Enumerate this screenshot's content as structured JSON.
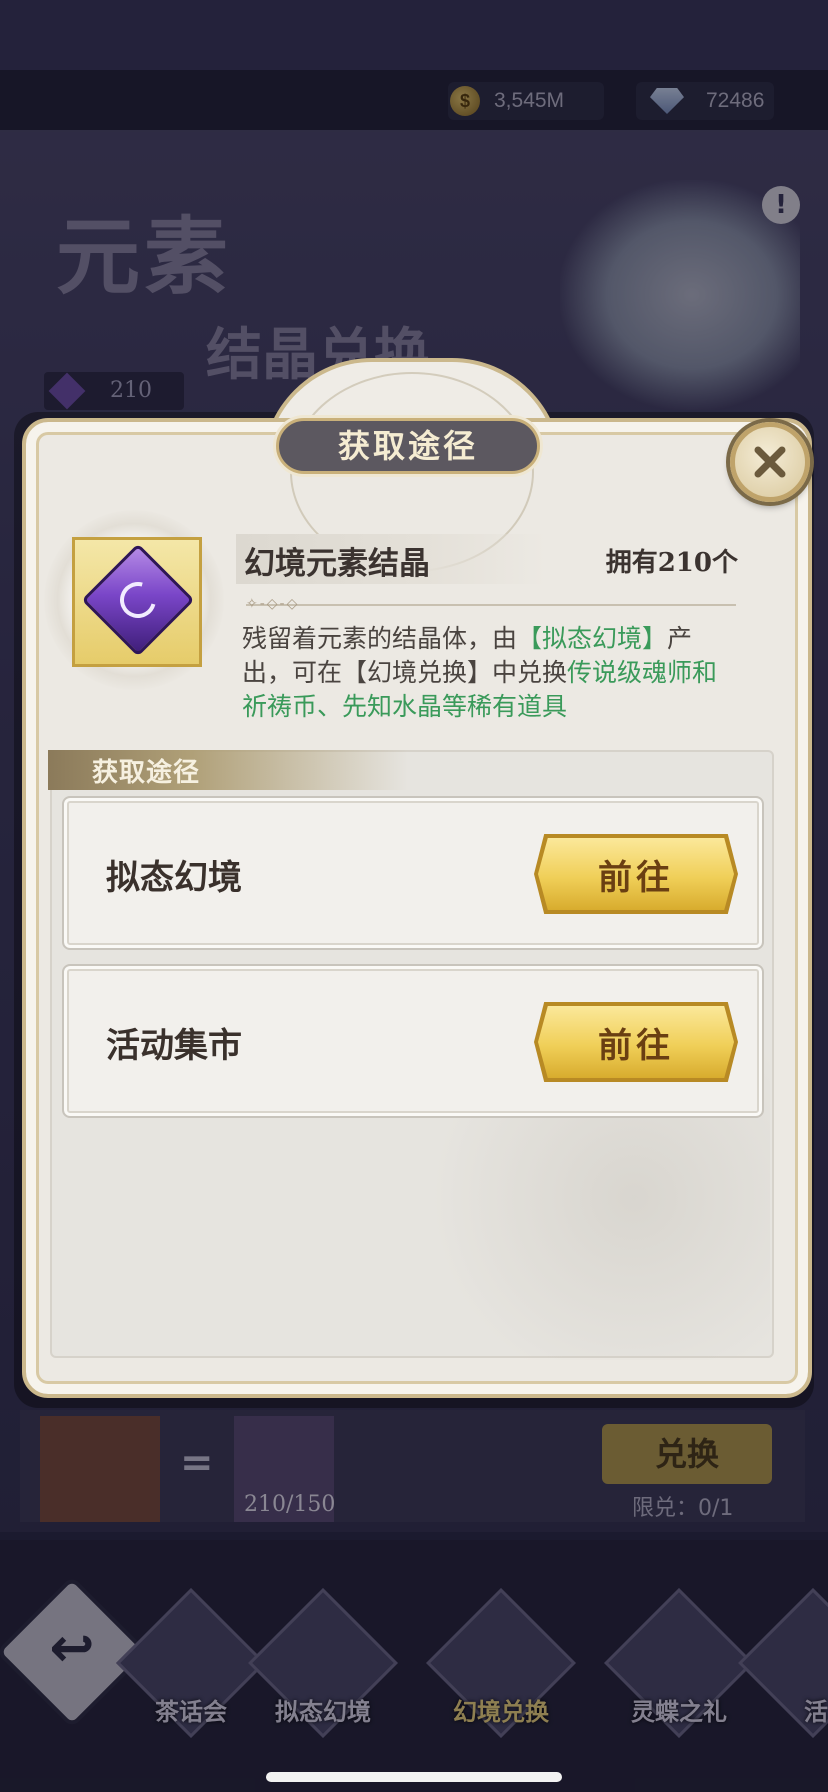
{
  "currency": {
    "gold": "3,545M",
    "gems": "72486"
  },
  "background": {
    "banner_line1": "元素",
    "banner_line2": "结晶兑换",
    "owned_count": "210",
    "exchange_button": "兑换",
    "exchange_limit": "限兑：0/1",
    "item_progress": "210/150",
    "warning_mark": "!"
  },
  "bottom_nav": {
    "back_glyph": "↩",
    "tabs": [
      {
        "label": "茶话会",
        "active": false
      },
      {
        "label": "拟态幻境",
        "active": false
      },
      {
        "label": "幻境兑换",
        "active": true
      },
      {
        "label": "灵蝶之礼",
        "active": false
      },
      {
        "label": "活",
        "active": false
      }
    ]
  },
  "modal": {
    "title": "获取途径",
    "item": {
      "name": "幻境元素结晶",
      "owned": "拥有210个",
      "icon": "purple-crystal-moon-icon",
      "desc_part1": "残留着元素的结晶体，由",
      "desc_hl1": "【拟态幻境】",
      "desc_part2": "产出，可在【幻境兑换】中兑换",
      "desc_hl2": "传说级魂师和祈祷币、先知水晶等稀有道具"
    },
    "section_title": "获取途径",
    "routes": [
      {
        "name": "拟态幻境",
        "button": "前往"
      },
      {
        "name": "活动集市",
        "button": "前往"
      }
    ]
  },
  "colors": {
    "highlight_green": "#3a9a5a",
    "button_gold": "#f0cf58",
    "modal_bg": "#ece9e3"
  }
}
